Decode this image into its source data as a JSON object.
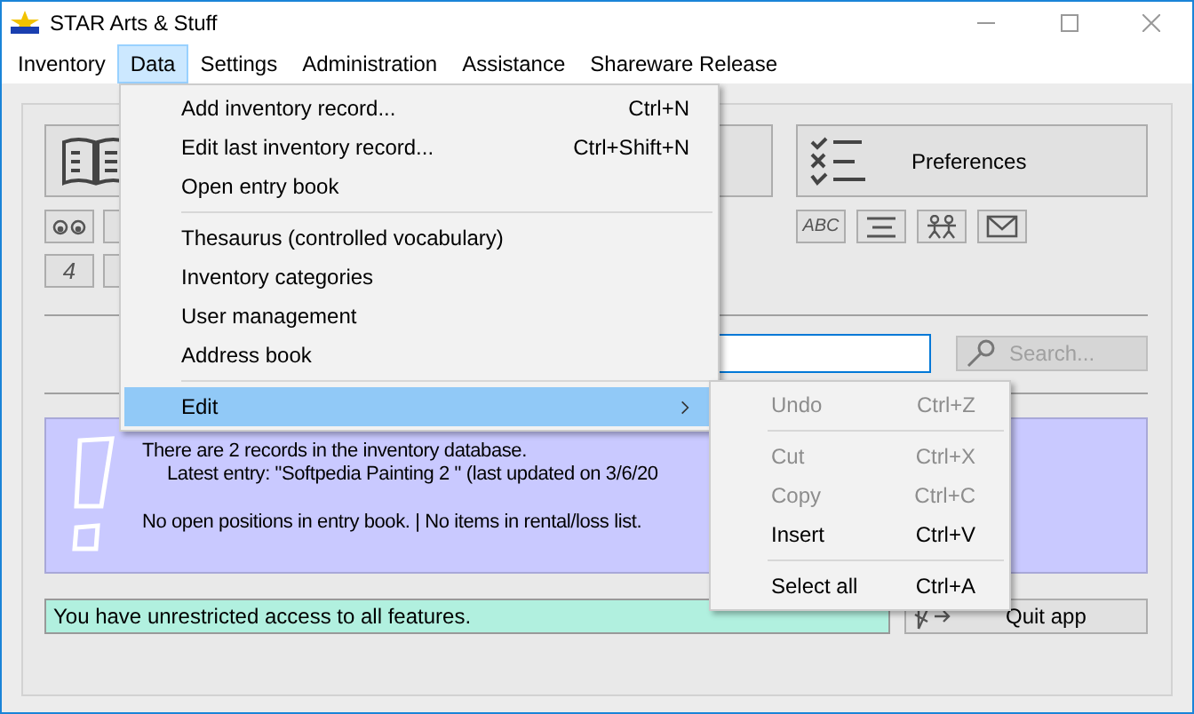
{
  "window": {
    "title": "STAR Arts & Stuff"
  },
  "menu_bar": [
    {
      "label": "Inventory",
      "selected": false
    },
    {
      "label": "Data",
      "selected": true
    },
    {
      "label": "Settings",
      "selected": false
    },
    {
      "label": "Administration",
      "selected": false
    },
    {
      "label": "Assistance",
      "selected": false
    },
    {
      "label": "Shareware Release",
      "selected": false
    }
  ],
  "toolbar": {
    "preferences_button": "Preferences",
    "digit_button": "4",
    "letters_button": "ABC"
  },
  "search": {
    "button": "Search...",
    "disabled": true
  },
  "info_panel": {
    "lines": [
      {
        "text": "There are 2 records in the inventory database.",
        "indent": false
      },
      {
        "text": "Latest entry: \"Softpedia Painting 2 \" (last updated on 3/6/20",
        "indent": true
      },
      {
        "text": "No open positions in entry book. | No items in rental/loss list.",
        "indent": false
      }
    ]
  },
  "status": "You have unrestricted access to all features.",
  "quit_button": "Quit app",
  "data_menu": {
    "items": [
      {
        "kind": "item",
        "label": "Add inventory record...",
        "shortcut": "Ctrl+N",
        "selected": false
      },
      {
        "kind": "item",
        "label": "Edit last inventory record...",
        "shortcut": "Ctrl+Shift+N",
        "selected": false
      },
      {
        "kind": "item",
        "label": "Open entry book",
        "selected": false
      },
      {
        "kind": "separator"
      },
      {
        "kind": "item",
        "label": "Thesaurus (controlled vocabulary)",
        "selected": false
      },
      {
        "kind": "item",
        "label": "Inventory categories",
        "selected": false
      },
      {
        "kind": "item",
        "label": "User management",
        "selected": false
      },
      {
        "kind": "item",
        "label": "Address book",
        "selected": false
      },
      {
        "kind": "separator"
      },
      {
        "kind": "submenu",
        "label": "Edit",
        "selected": true
      }
    ]
  },
  "edit_submenu": {
    "items": [
      {
        "kind": "item",
        "label": "Undo",
        "shortcut": "Ctrl+Z",
        "disabled": true
      },
      {
        "kind": "separator"
      },
      {
        "kind": "item",
        "label": "Cut",
        "shortcut": "Ctrl+X",
        "disabled": true
      },
      {
        "kind": "item",
        "label": "Copy",
        "shortcut": "Ctrl+C",
        "disabled": true
      },
      {
        "kind": "item",
        "label": "Insert",
        "shortcut": "Ctrl+V",
        "disabled": false
      },
      {
        "kind": "separator"
      },
      {
        "kind": "item",
        "label": "Select all",
        "shortcut": "Ctrl+A",
        "disabled": false
      }
    ]
  }
}
